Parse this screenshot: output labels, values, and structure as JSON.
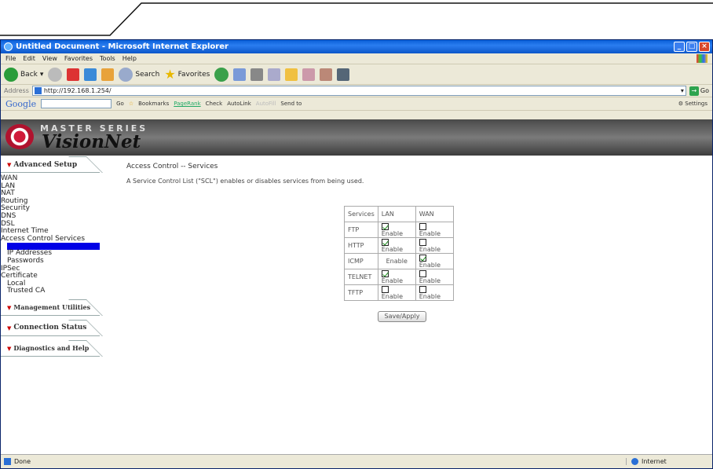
{
  "window": {
    "title": "Untitled Document - Microsoft Internet Explorer"
  },
  "menu": [
    "File",
    "Edit",
    "View",
    "Favorites",
    "Tools",
    "Help"
  ],
  "toolbar": {
    "back": "Back",
    "search": "Search",
    "favorites": "Favorites"
  },
  "address": {
    "label": "Address",
    "url": "http://192.168.1.254/",
    "go": "Go"
  },
  "google_bar": {
    "logo": "Google",
    "go": "Go",
    "bookmarks": "Bookmarks",
    "pagerank": "PageRank",
    "check": "Check",
    "autolink": "AutoLink",
    "autofill": "AutoFill",
    "sendto": "Send to",
    "settings": "Settings"
  },
  "banner": {
    "series": "MASTER SERIES",
    "brand": "VisionNet"
  },
  "sidebar": {
    "advanced_setup": "Advanced Setup",
    "items": [
      {
        "label": "WAN",
        "level": 0
      },
      {
        "label": "LAN",
        "level": 0
      },
      {
        "label": "NAT",
        "level": 0
      },
      {
        "label": "Routing",
        "level": 0
      },
      {
        "label": "Security",
        "level": 0
      },
      {
        "label": "DNS",
        "level": 0
      },
      {
        "label": "DSL",
        "level": 0
      },
      {
        "label": "Internet Time",
        "level": 0
      },
      {
        "label": "Access Control Services",
        "level": 0
      }
    ],
    "sub_items": [
      "IP Addresses",
      "Passwords"
    ],
    "after_items": [
      "IPSec",
      "Certificate"
    ],
    "cert_items": [
      "Local",
      "Trusted CA"
    ],
    "management": "Management Utilities",
    "connection": "Connection Status",
    "diagnostics": "Diagnostics and Help"
  },
  "content": {
    "title": "Access Control -- Services",
    "description": "A Service Control List (\"SCL\") enables or disables services from being used.",
    "headers": [
      "Services",
      "LAN",
      "WAN"
    ],
    "rows": [
      {
        "service": "FTP",
        "lan_checked": true,
        "lan": "Enable",
        "wan_checked": false,
        "wan": "Enable"
      },
      {
        "service": "HTTP",
        "lan_checked": true,
        "lan": "Enable",
        "wan_checked": false,
        "wan": "Enable"
      },
      {
        "service": "ICMP",
        "lan_checked": null,
        "lan": "Enable",
        "wan_checked": true,
        "wan": "Enable"
      },
      {
        "service": "TELNET",
        "lan_checked": true,
        "lan": "Enable",
        "wan_checked": false,
        "wan": "Enable"
      },
      {
        "service": "TFTP",
        "lan_checked": false,
        "lan": "Enable",
        "wan_checked": false,
        "wan": "Enable"
      }
    ],
    "save_label": "Save/Apply"
  },
  "status": {
    "text": "Done",
    "zone": "Internet"
  }
}
